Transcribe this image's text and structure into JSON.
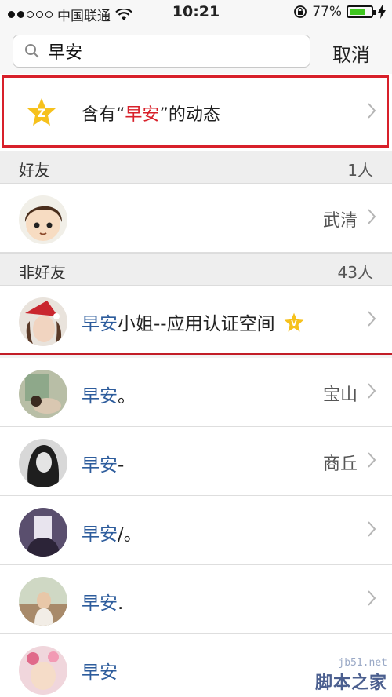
{
  "status_bar": {
    "carrier": "中国联通",
    "time": "10:21",
    "battery": "77%",
    "battery_level": 0.77
  },
  "search": {
    "value": "早安",
    "cancel_label": "取消"
  },
  "feed_result": {
    "prefix": "含有“",
    "keyword": "早安",
    "suffix": "”的动态"
  },
  "sections": {
    "friends": {
      "title": "好友",
      "count": "1人"
    },
    "non_friends": {
      "title": "非好友",
      "count": "43人"
    }
  },
  "friends": [
    {
      "name": "",
      "location": "武清"
    }
  ],
  "non_friends": [
    {
      "match": "早安",
      "rest": "小姐--应用认证空间",
      "location": "",
      "verified": true
    },
    {
      "match": "早安",
      "rest": "。",
      "location": "宝山"
    },
    {
      "match": "早安",
      "rest": "-",
      "location": "商丘"
    },
    {
      "match": "早安",
      "rest": "/。",
      "location": ""
    },
    {
      "match": "早安",
      "rest": ".",
      "location": ""
    },
    {
      "match": "早安",
      "rest": "",
      "location": ""
    }
  ],
  "watermark": {
    "url": "jb51.net",
    "site": "脚本之家"
  },
  "colors": {
    "highlight_border": "#d8202a",
    "match_text": "#2d5c9c",
    "battery_fill": "#3fc61f"
  }
}
